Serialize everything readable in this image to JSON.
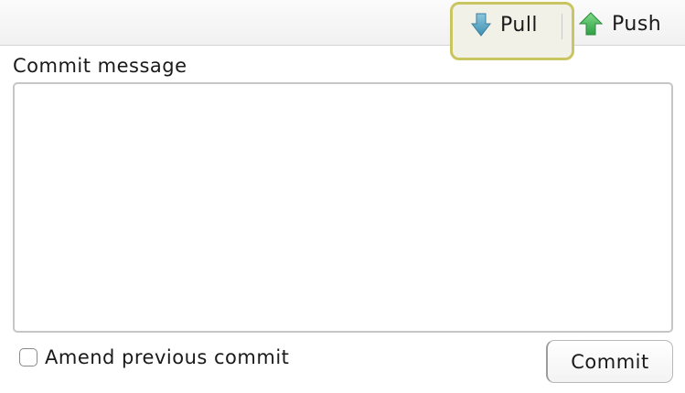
{
  "toolbar": {
    "pull": {
      "label": "Pull",
      "icon": "arrow-down-icon",
      "icon_color": "#5aa7c5"
    },
    "push": {
      "label": "Push",
      "icon": "arrow-up-icon",
      "icon_color": "#4cbf5e"
    },
    "highlight_color": "#c9c662"
  },
  "commit": {
    "message_label": "Commit message",
    "message_value": "",
    "amend_label": "Amend previous commit",
    "amend_checked": false,
    "button_label": "Commit"
  }
}
